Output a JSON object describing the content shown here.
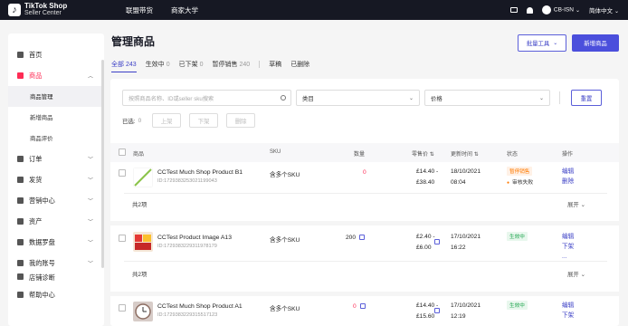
{
  "topbar": {
    "logo_line1": "TikTok Shop",
    "logo_line2": "Seller Center",
    "nav": [
      "联盟带货",
      "商家大学"
    ],
    "account": "CB-ISN",
    "language": "简体中文"
  },
  "sidebar": {
    "items": [
      {
        "label": "首页",
        "icon": "home-icon"
      },
      {
        "label": "商品",
        "icon": "product-icon",
        "active": true,
        "sub": [
          "商品管理",
          "新增商品",
          "商品评价"
        ]
      },
      {
        "label": "订单",
        "icon": "order-icon"
      },
      {
        "label": "发货",
        "icon": "shipping-icon"
      },
      {
        "label": "营销中心",
        "icon": "megaphone-icon"
      },
      {
        "label": "资产",
        "icon": "wallet-icon"
      },
      {
        "label": "数据罗盘",
        "icon": "chart-icon"
      },
      {
        "label": "我的账号",
        "icon": "user-icon"
      },
      {
        "label": "店铺诊断",
        "icon": "diagnosis-icon"
      },
      {
        "label": "帮助中心",
        "icon": "help-icon"
      }
    ]
  },
  "page": {
    "title": "管理商品",
    "batch_tools": "批量工具",
    "add_product": "新增商品"
  },
  "tabs": [
    {
      "label": "全部",
      "count": "243",
      "active": true
    },
    {
      "label": "生效中",
      "count": "0"
    },
    {
      "label": "已下架",
      "count": "0"
    },
    {
      "label": "暂停销售",
      "count": "240"
    },
    {
      "label": "草稿",
      "count": ""
    },
    {
      "label": "已删除",
      "count": ""
    }
  ],
  "filters": {
    "search_placeholder": "按照商品名称、ID或seller sku搜索",
    "category": "类目",
    "price": "价格",
    "reset": "重置"
  },
  "selection": {
    "label": "已选:",
    "count": "0",
    "list": "上架",
    "delist": "下架",
    "delete": "删除"
  },
  "table": {
    "headers": [
      "商品",
      "SKU",
      "数量",
      "零售价",
      "更新时间",
      "状态",
      "操作"
    ],
    "rows": [
      {
        "name": "CCTest Much Shop Product B1",
        "id": "ID:1729383253021199043",
        "sku": "含多个SKU",
        "qty": "0",
        "price_line1": "£14.40 -",
        "price_line2": "£38.40",
        "date_line1": "18/10/2021",
        "date_line2": "08:04",
        "status": "暂停销售",
        "audit": "审核失败",
        "actions": [
          "编辑",
          "删除"
        ],
        "total": "共2项",
        "expand": "展开"
      },
      {
        "name": "CCTest Product Image A13",
        "id": "ID:1729383229311978179",
        "sku": "含多个SKU",
        "qty": "200",
        "price_line1": "£2.40 -",
        "price_line2": "£6.00",
        "date_line1": "17/10/2021",
        "date_line2": "16:22",
        "status": "生效中",
        "actions": [
          "编辑",
          "下架",
          "..."
        ],
        "total": "共2项",
        "expand": "展开"
      },
      {
        "name": "CCTest Much Shop Product A1",
        "id": "ID:1729383229315517123",
        "sku": "含多个SKU",
        "qty": "0",
        "price_line1": "£14.40 -",
        "price_line2": "£15.60",
        "date_line1": "17/10/2021",
        "date_line2": "12:19",
        "status": "生效中",
        "actions": [
          "编辑",
          "下架"
        ]
      }
    ]
  }
}
